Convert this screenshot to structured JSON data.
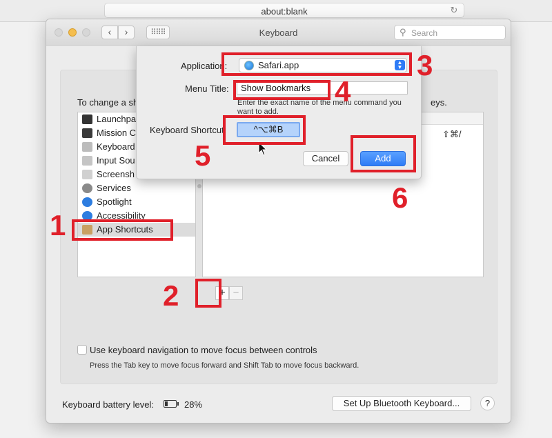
{
  "browser": {
    "url": "about:blank",
    "reload_icon": "reload-icon"
  },
  "window": {
    "title": "Keyboard",
    "nav_back": "‹",
    "nav_forward": "›",
    "grid_glyph": "⠿⠿⠿",
    "search_placeholder": "Search"
  },
  "hints": {
    "left": "To change a sh",
    "right": "eys."
  },
  "categories": [
    {
      "label": "Launchpa",
      "icon": "launchpad-icon",
      "color": "#333333"
    },
    {
      "label": "Mission C",
      "icon": "mission-control-icon",
      "color": "#3a3a3a"
    },
    {
      "label": "Keyboard",
      "icon": "keyboard-icon",
      "color": "#bcbcbc"
    },
    {
      "label": "Input Sou",
      "icon": "input-sources-icon",
      "color": "#c5c5c5"
    },
    {
      "label": "Screensh",
      "icon": "screenshot-icon",
      "color": "#d0d0d0"
    },
    {
      "label": "Services",
      "icon": "gear-icon",
      "color": "#8a8a8a"
    },
    {
      "label": "Spotlight",
      "icon": "spotlight-icon",
      "color": "#2d7de0"
    },
    {
      "label": "Accessibility",
      "icon": "accessibility-icon",
      "color": "#2d7de0"
    },
    {
      "label": "App Shortcuts",
      "icon": "app-shortcuts-icon",
      "color": "#c9a062"
    }
  ],
  "shortcut_list": {
    "first_shortcut": "⇧⌘/"
  },
  "controls": {
    "add_glyph": "+",
    "remove_glyph": "−"
  },
  "keyboard_nav": {
    "label": "Use keyboard navigation to move focus between controls",
    "help": "Press the Tab key to move focus forward and Shift Tab to move focus backward."
  },
  "footer": {
    "battery_label": "Keyboard battery level:",
    "battery_percent": "28%",
    "battery_level": 0.28,
    "bluetooth_button": "Set Up Bluetooth Keyboard...",
    "help_glyph": "?"
  },
  "sheet": {
    "application_label": "Application:",
    "application_value": "Safari.app",
    "select_arrows": "▲▼",
    "menu_title_label": "Menu Title:",
    "menu_title_value": "Show Bookmarks",
    "menu_help": "Enter the exact name of the menu command you want to add.",
    "shortcut_label": "Keyboard Shortcut:",
    "shortcut_value": "^⌥⌘B",
    "cancel_label": "Cancel",
    "add_label": "Add"
  },
  "annotations": {
    "step1": "1",
    "step2": "2",
    "step3": "3",
    "step4": "4",
    "step5": "5",
    "step6": "6",
    "color": "#e0202a"
  }
}
